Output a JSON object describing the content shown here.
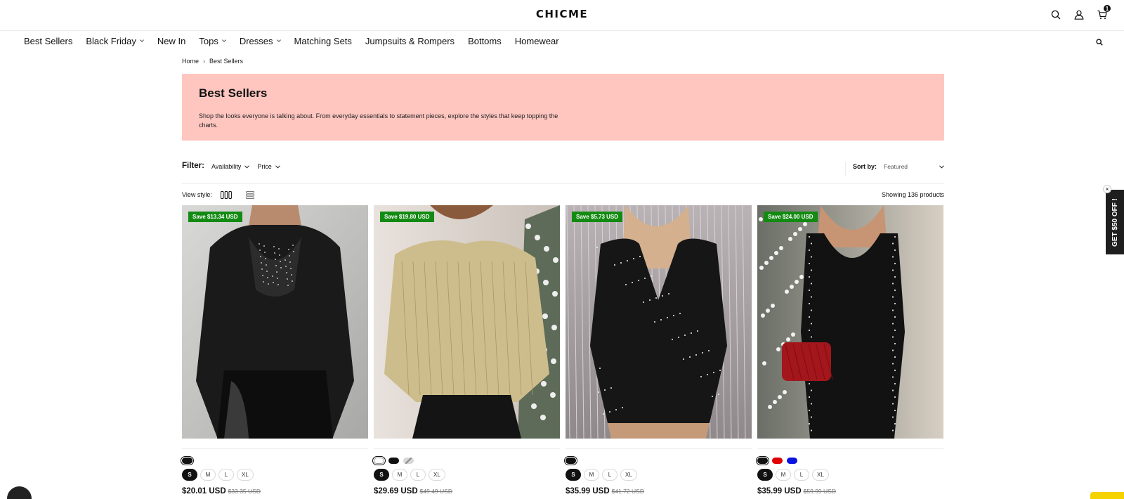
{
  "header": {
    "logo": "CHICME",
    "cart_count": "1"
  },
  "nav": {
    "items": [
      {
        "label": "Best Sellers",
        "dropdown": false
      },
      {
        "label": "Black Friday",
        "dropdown": true
      },
      {
        "label": "New In",
        "dropdown": false
      },
      {
        "label": "Tops",
        "dropdown": true
      },
      {
        "label": "Dresses",
        "dropdown": true
      },
      {
        "label": "Matching Sets",
        "dropdown": false
      },
      {
        "label": "Jumpsuits & Rompers",
        "dropdown": false
      },
      {
        "label": "Bottoms",
        "dropdown": false
      },
      {
        "label": "Homewear",
        "dropdown": false
      }
    ]
  },
  "breadcrumb": {
    "home": "Home",
    "current": "Best Sellers"
  },
  "banner": {
    "title": "Best Sellers",
    "description": "Shop the looks everyone is talking about. From everyday essentials to statement pieces, explore the styles that keep topping the charts.",
    "bg_color": "#ffc6c0"
  },
  "filter": {
    "label": "Filter:",
    "availability": "Availability",
    "price": "Price",
    "sort_label": "Sort by:",
    "sort_value": "Featured"
  },
  "view": {
    "label": "View style:",
    "showing": "Showing 136 products"
  },
  "products": [
    {
      "save": "Save $13.34 USD",
      "price": "$20.01 USD",
      "was": "$33.35 USD",
      "swatches": [
        "#111111"
      ],
      "sizes": [
        "S",
        "M",
        "L",
        "XL"
      ]
    },
    {
      "save": "Save $19.80 USD",
      "price": "$29.69 USD",
      "was": "$49.49 USD",
      "swatches": [
        "#ffffff",
        "#111111",
        "#b9b9b9"
      ],
      "sizes": [
        "S",
        "M",
        "L",
        "XL"
      ]
    },
    {
      "save": "Save $5.73 USD",
      "price": "$35.99 USD",
      "was": "$41.72 USD",
      "swatches": [
        "#111111"
      ],
      "sizes": [
        "S",
        "M",
        "L",
        "XL"
      ]
    },
    {
      "save": "Save $24.00 USD",
      "price": "$35.99 USD",
      "was": "$59.99 USD",
      "swatches": [
        "#111111",
        "#e00000",
        "#0a14e0"
      ],
      "sizes": [
        "S",
        "M",
        "L",
        "XL"
      ]
    }
  ],
  "side_tab": {
    "label": "GET $50 OFF !",
    "close": "×"
  },
  "colors": {
    "save_badge": "#138a12",
    "accent": "#111111"
  }
}
